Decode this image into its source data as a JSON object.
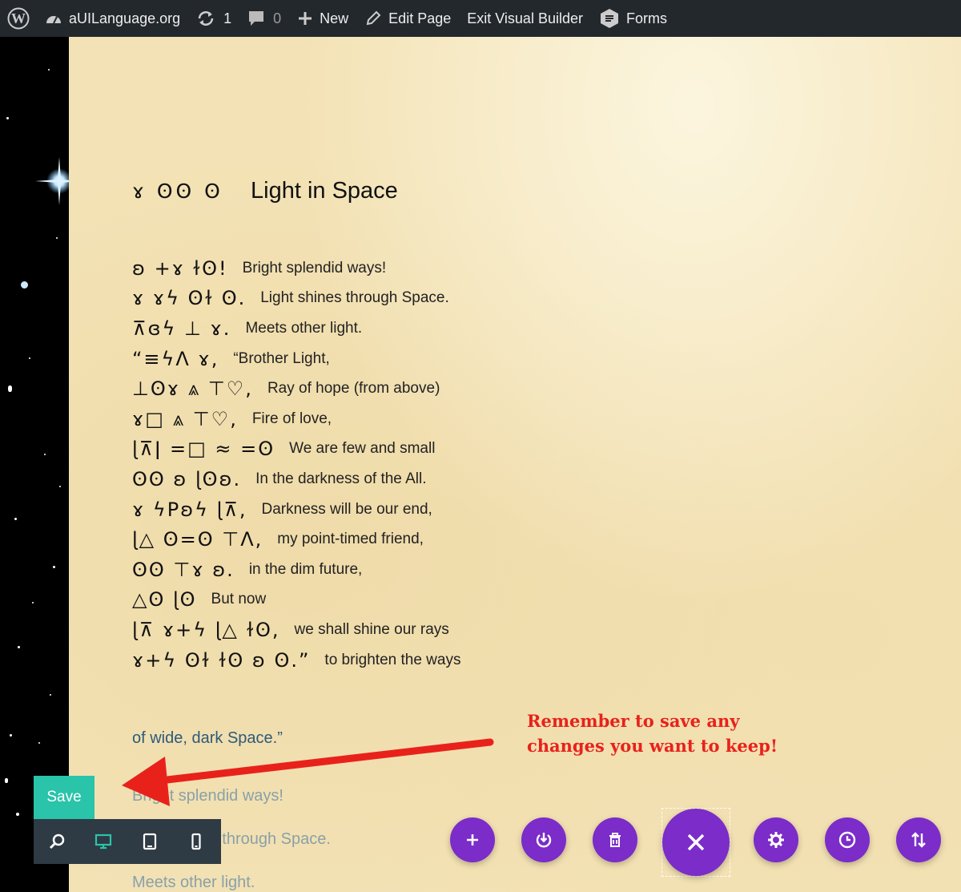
{
  "admin_bar": {
    "site_name": "aUILanguage.org",
    "updates_count": "1",
    "comments_count": "0",
    "new_label": "New",
    "edit_page_label": "Edit Page",
    "exit_builder_label": "Exit Visual Builder",
    "forms_label": "Forms"
  },
  "poem": {
    "title_glyphs": "ɤ ʘʘ ʘ",
    "title": "Light in Space",
    "lines": [
      {
        "glyphs": "ʚ +ɤ ɫʘ!",
        "english": "Bright splendid ways!"
      },
      {
        "glyphs": "ɤ ɤϟ ʘɫ ʘ.",
        "english": "Light shines through Space."
      },
      {
        "glyphs": "⊼ɞϟ ⊥ ɤ.",
        "english": "Meets other light."
      },
      {
        "glyphs": "“≡ϟΛ ɤ,",
        "english": "“Brother Light,"
      },
      {
        "glyphs": "⊥ʘɤ ⩓ ⊤♡,",
        "english": "Ray of hope (from above)"
      },
      {
        "glyphs": "ɤ□ ⩓ ⊤♡,",
        "english": "Fire of love,"
      },
      {
        "glyphs": "ɭ⊼ǀ =□ ≈ =ʘ",
        "english": "We are few and small"
      },
      {
        "glyphs": "ʘʘ ʚ ɭʘʚ.",
        "english": "In the darkness of the All."
      },
      {
        "glyphs": "ɤ ϟPʚϟ ɭ⊼,",
        "english": "Darkness will be our end,"
      },
      {
        "glyphs": "ɭ△ ʘ=ʘ ⊤Λ,",
        "english": "my point-timed friend,"
      },
      {
        "glyphs": "ʘʘ ⊤ɤ ʚ.",
        "english": "in the dim future,"
      },
      {
        "glyphs": "△ʘ ɭʘ",
        "english": "But now"
      },
      {
        "glyphs": "ɭ⊼ ɤ+ϟ ɭ△ ɫʘ,",
        "english": "we shall shine our rays"
      },
      {
        "glyphs": "ɤ+ϟ ʘɫ ɫʘ ʚ ʘ.”",
        "english": "to brighten the ways"
      }
    ],
    "preview_lines": [
      "of wide, dark Space.”",
      "Bright splendid ways!",
      "Light shines through Space.",
      "Meets other light."
    ]
  },
  "annotation": {
    "line1": "Remember to save any",
    "line2": "changes you want to keep!",
    "color": "#e8221b"
  },
  "builder": {
    "save_label": "Save",
    "save_color": "#29c4a9",
    "accent_color": "#7b2cc9",
    "view_modes": [
      "zoom-icon",
      "desktop-icon",
      "tablet-icon",
      "phone-icon"
    ],
    "page_actions": [
      "add-icon",
      "portability-icon",
      "trash-icon",
      "close-icon",
      "gear-icon",
      "history-icon",
      "sort-icon"
    ]
  }
}
